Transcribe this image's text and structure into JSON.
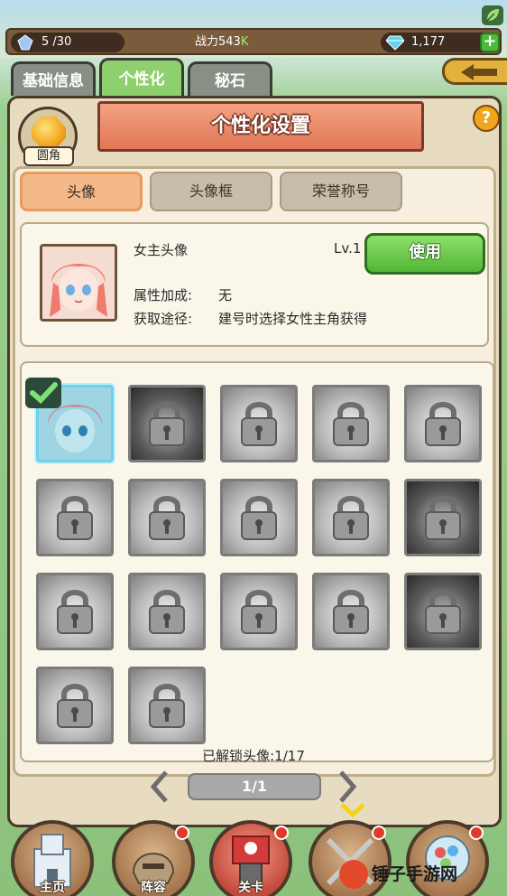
{
  "topbar": {
    "stamina": "5 /30",
    "power_label": "战力",
    "power_value": "543",
    "power_suffix": "K",
    "gems": "1,177"
  },
  "tabs": [
    {
      "label": "基础信息"
    },
    {
      "label": "个性化"
    },
    {
      "label": "秘石"
    }
  ],
  "banner_title": "个性化设置",
  "corner_label": "圆角",
  "help_label": "?",
  "subtabs": [
    {
      "label": "头像"
    },
    {
      "label": "头像框"
    },
    {
      "label": "荣誉称号"
    }
  ],
  "info": {
    "name": "女主头像",
    "level": "Lv.1",
    "use_label": "使用",
    "attr_label": "属性加成:",
    "attr_value": "无",
    "source_label": "获取途径:",
    "source_value": "建号时选择女性主角获得"
  },
  "grid": {
    "unlocked_text": "已解锁头像:1/17",
    "total": 17,
    "unlocked": 1
  },
  "pager": {
    "text": "1/1"
  },
  "nav": [
    {
      "label": "主页"
    },
    {
      "label": "阵容"
    },
    {
      "label": "关卡"
    },
    {
      "label": ""
    },
    {
      "label": ""
    }
  ],
  "watermark": "锤子手游网",
  "colors": {
    "accent_green": "#52b636",
    "banner": "#e27756",
    "panel": "#e8dcc0",
    "selected_border": "#6fd0e8"
  }
}
